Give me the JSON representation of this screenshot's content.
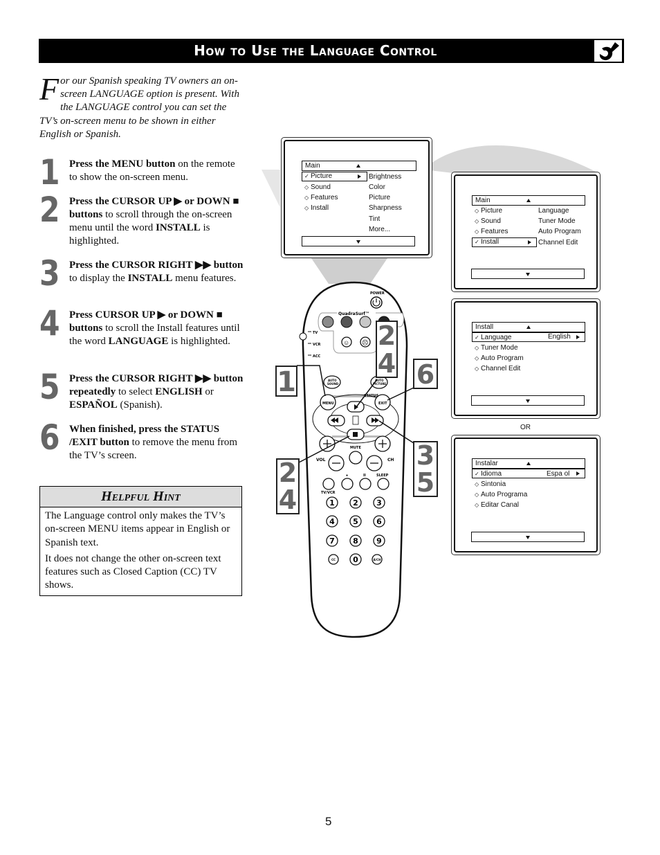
{
  "header": {
    "title": "How to Use the Language Control",
    "icon": "wrench-icon"
  },
  "intro": {
    "dropcap": "F",
    "text": "or our Spanish speaking TV owners an on-screen LANGUAGE option is present. With the LANGUAGE control you can set the TV’s on-screen menu to be shown in either English or Spanish."
  },
  "steps": [
    {
      "num": "1",
      "bold": "Press the MENU button",
      "rest": " on the remote to show the on-screen menu."
    },
    {
      "num": "2",
      "bold_a": "Press the CURSOR UP ▶ or DOWN ■ buttons",
      "rest_a": " to scroll through the on-screen menu until the word ",
      "bold_b": "INSTALL",
      "rest_b": " is highlighted."
    },
    {
      "num": "3",
      "bold_a": "Press the CURSOR RIGHT ▶▶ button",
      "rest_a": " to display the ",
      "bold_b": "INSTALL",
      "rest_b": " menu features."
    },
    {
      "num": "4",
      "bold_a": "Press CURSOR UP ▶ or DOWN ■ buttons",
      "rest_a": " to scroll the Install features until the word ",
      "bold_b": "LANGUAGE",
      "rest_b": " is highlighted."
    },
    {
      "num": "5",
      "bold_a": "Press the CURSOR RIGHT ▶▶ button repeatedly",
      "rest_a": " to select ",
      "bold_b": "ENGLISH",
      "rest_b": " or ",
      "bold_c": "ESPAÑOL",
      "rest_c": " (Spanish)."
    },
    {
      "num": "6",
      "bold_a": "When finished, press the STATUS /EXIT button",
      "rest_a": " to remove the menu from the TV’s screen."
    }
  ],
  "hint": {
    "title": "Helpful Hint",
    "p1": "The Language control only makes the TV’s on-screen MENU items appear in English or Spanish text.",
    "p2": "It does not change the other on-screen text features such as Closed Caption (CC) TV shows."
  },
  "screens": {
    "s1": {
      "title": "Main",
      "items": [
        {
          "mark": "✓",
          "label": "Picture",
          "selected": true
        },
        {
          "mark": "◇",
          "label": "Sound"
        },
        {
          "mark": "◇",
          "label": "Features"
        },
        {
          "mark": "◇",
          "label": "Install"
        }
      ],
      "sub": [
        "Brightness",
        "Color",
        "Picture",
        "Sharpness",
        "Tint",
        "More..."
      ]
    },
    "s2": {
      "title": "Main",
      "items": [
        {
          "mark": "◇",
          "label": "Picture"
        },
        {
          "mark": "◇",
          "label": "Sound"
        },
        {
          "mark": "◇",
          "label": "Features"
        },
        {
          "mark": "✓",
          "label": "Install",
          "selected": true
        }
      ],
      "sub": [
        "Language",
        "Tuner Mode",
        "Auto Program",
        "Channel Edit"
      ]
    },
    "s3": {
      "title": "Install",
      "items": [
        {
          "mark": "✓",
          "label": "Language",
          "value": "English",
          "selected": true
        },
        {
          "mark": "◇",
          "label": "Tuner Mode"
        },
        {
          "mark": "◇",
          "label": "Auto Program"
        },
        {
          "mark": "◇",
          "label": "Channel Edit"
        }
      ]
    },
    "or_label": "OR",
    "s4": {
      "title": "Instalar",
      "items": [
        {
          "mark": "✓",
          "label": "Idioma",
          "value": "Espa ol",
          "selected": true
        },
        {
          "mark": "◇",
          "label": "Sintonia"
        },
        {
          "mark": "◇",
          "label": "Auto Programa"
        },
        {
          "mark": "◇",
          "label": "Editar Canal"
        }
      ]
    }
  },
  "remote": {
    "power": "POWER",
    "quadrasurf": "QuadraSurf™",
    "modes": [
      "TV",
      "VCR",
      "ACC"
    ],
    "auto_sound": [
      "AUTO",
      "SOUND"
    ],
    "auto_picture": [
      "AUTO",
      "PICTURE"
    ],
    "menu": "MENU",
    "status": "STATUS",
    "exit": "EXIT",
    "vol": "VOL",
    "ch": "CH",
    "mute": "MUTE",
    "record": "●",
    "pause": "II",
    "sleep": "SLEEP",
    "tvvcr": "TV/VCR",
    "digits": [
      "1",
      "2",
      "3",
      "4",
      "5",
      "6",
      "7",
      "8",
      "9"
    ],
    "cc": "CC",
    "zero": "0",
    "ach": "A/CH",
    "colors": [
      "#8a8a8a",
      "#555555",
      "#c8c8c8",
      "#222222"
    ]
  },
  "callouts": {
    "c1": "1",
    "c24_top": [
      "2",
      "4"
    ],
    "c6": "6",
    "c35": [
      "3",
      "5"
    ],
    "c24_bottom": [
      "2",
      "4"
    ]
  },
  "page_number": "5"
}
